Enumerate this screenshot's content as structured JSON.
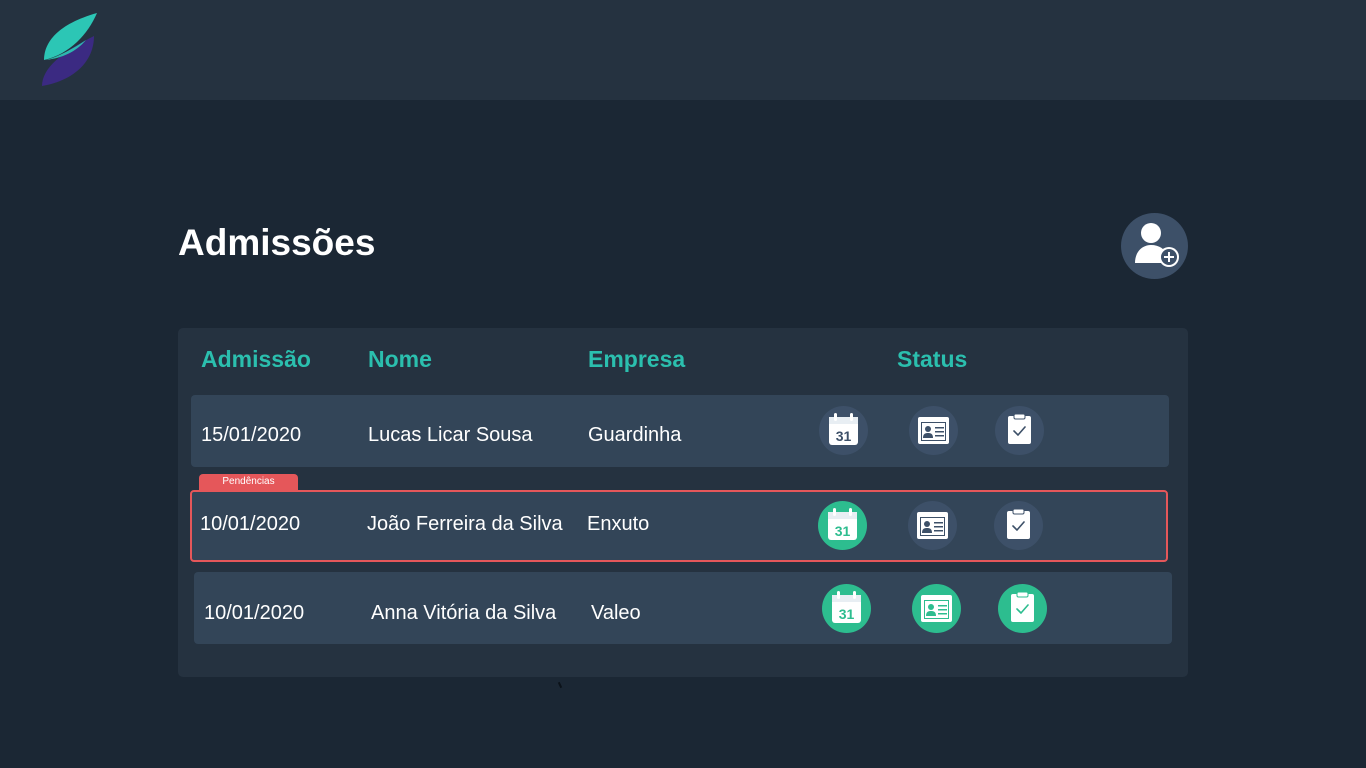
{
  "page": {
    "title": "Admissões"
  },
  "table": {
    "headers": {
      "admissao": "Admissão",
      "nome": "Nome",
      "empresa": "Empresa",
      "status": "Status"
    },
    "rows": [
      {
        "admissao": "15/01/2020",
        "nome": "Lucas Licar Sousa",
        "empresa": "Guardinha",
        "status": {
          "calendar_day": "31",
          "calendar_done": false,
          "document_done": false,
          "checklist_done": false
        },
        "pending": false
      },
      {
        "admissao": "10/01/2020",
        "nome": "João Ferreira da Silva",
        "empresa": "Enxuto",
        "status": {
          "calendar_day": "31",
          "calendar_done": true,
          "document_done": false,
          "checklist_done": false
        },
        "pending": true,
        "pending_label": "Pendências"
      },
      {
        "admissao": "10/01/2020",
        "nome": "Anna Vitória da Silva",
        "empresa": "Valeo",
        "status": {
          "calendar_day": "31",
          "calendar_done": true,
          "document_done": true,
          "checklist_done": true
        },
        "pending": false
      }
    ]
  },
  "colors": {
    "background": "#1b2734",
    "topbar": "#253240",
    "panel": "#253240",
    "row": "#334558",
    "accent_teal": "#2bbfae",
    "status_pending": "#3d5068",
    "status_done": "#2dbd8f",
    "alert_red": "#e5575a",
    "logo_teal": "#2cc6b5",
    "logo_purple": "#3b2a82"
  },
  "icons": {
    "logo": "leaf-logo",
    "add_user": "add-user-icon",
    "calendar": "calendar-icon",
    "document": "id-card-icon",
    "checklist": "clipboard-check-icon"
  }
}
